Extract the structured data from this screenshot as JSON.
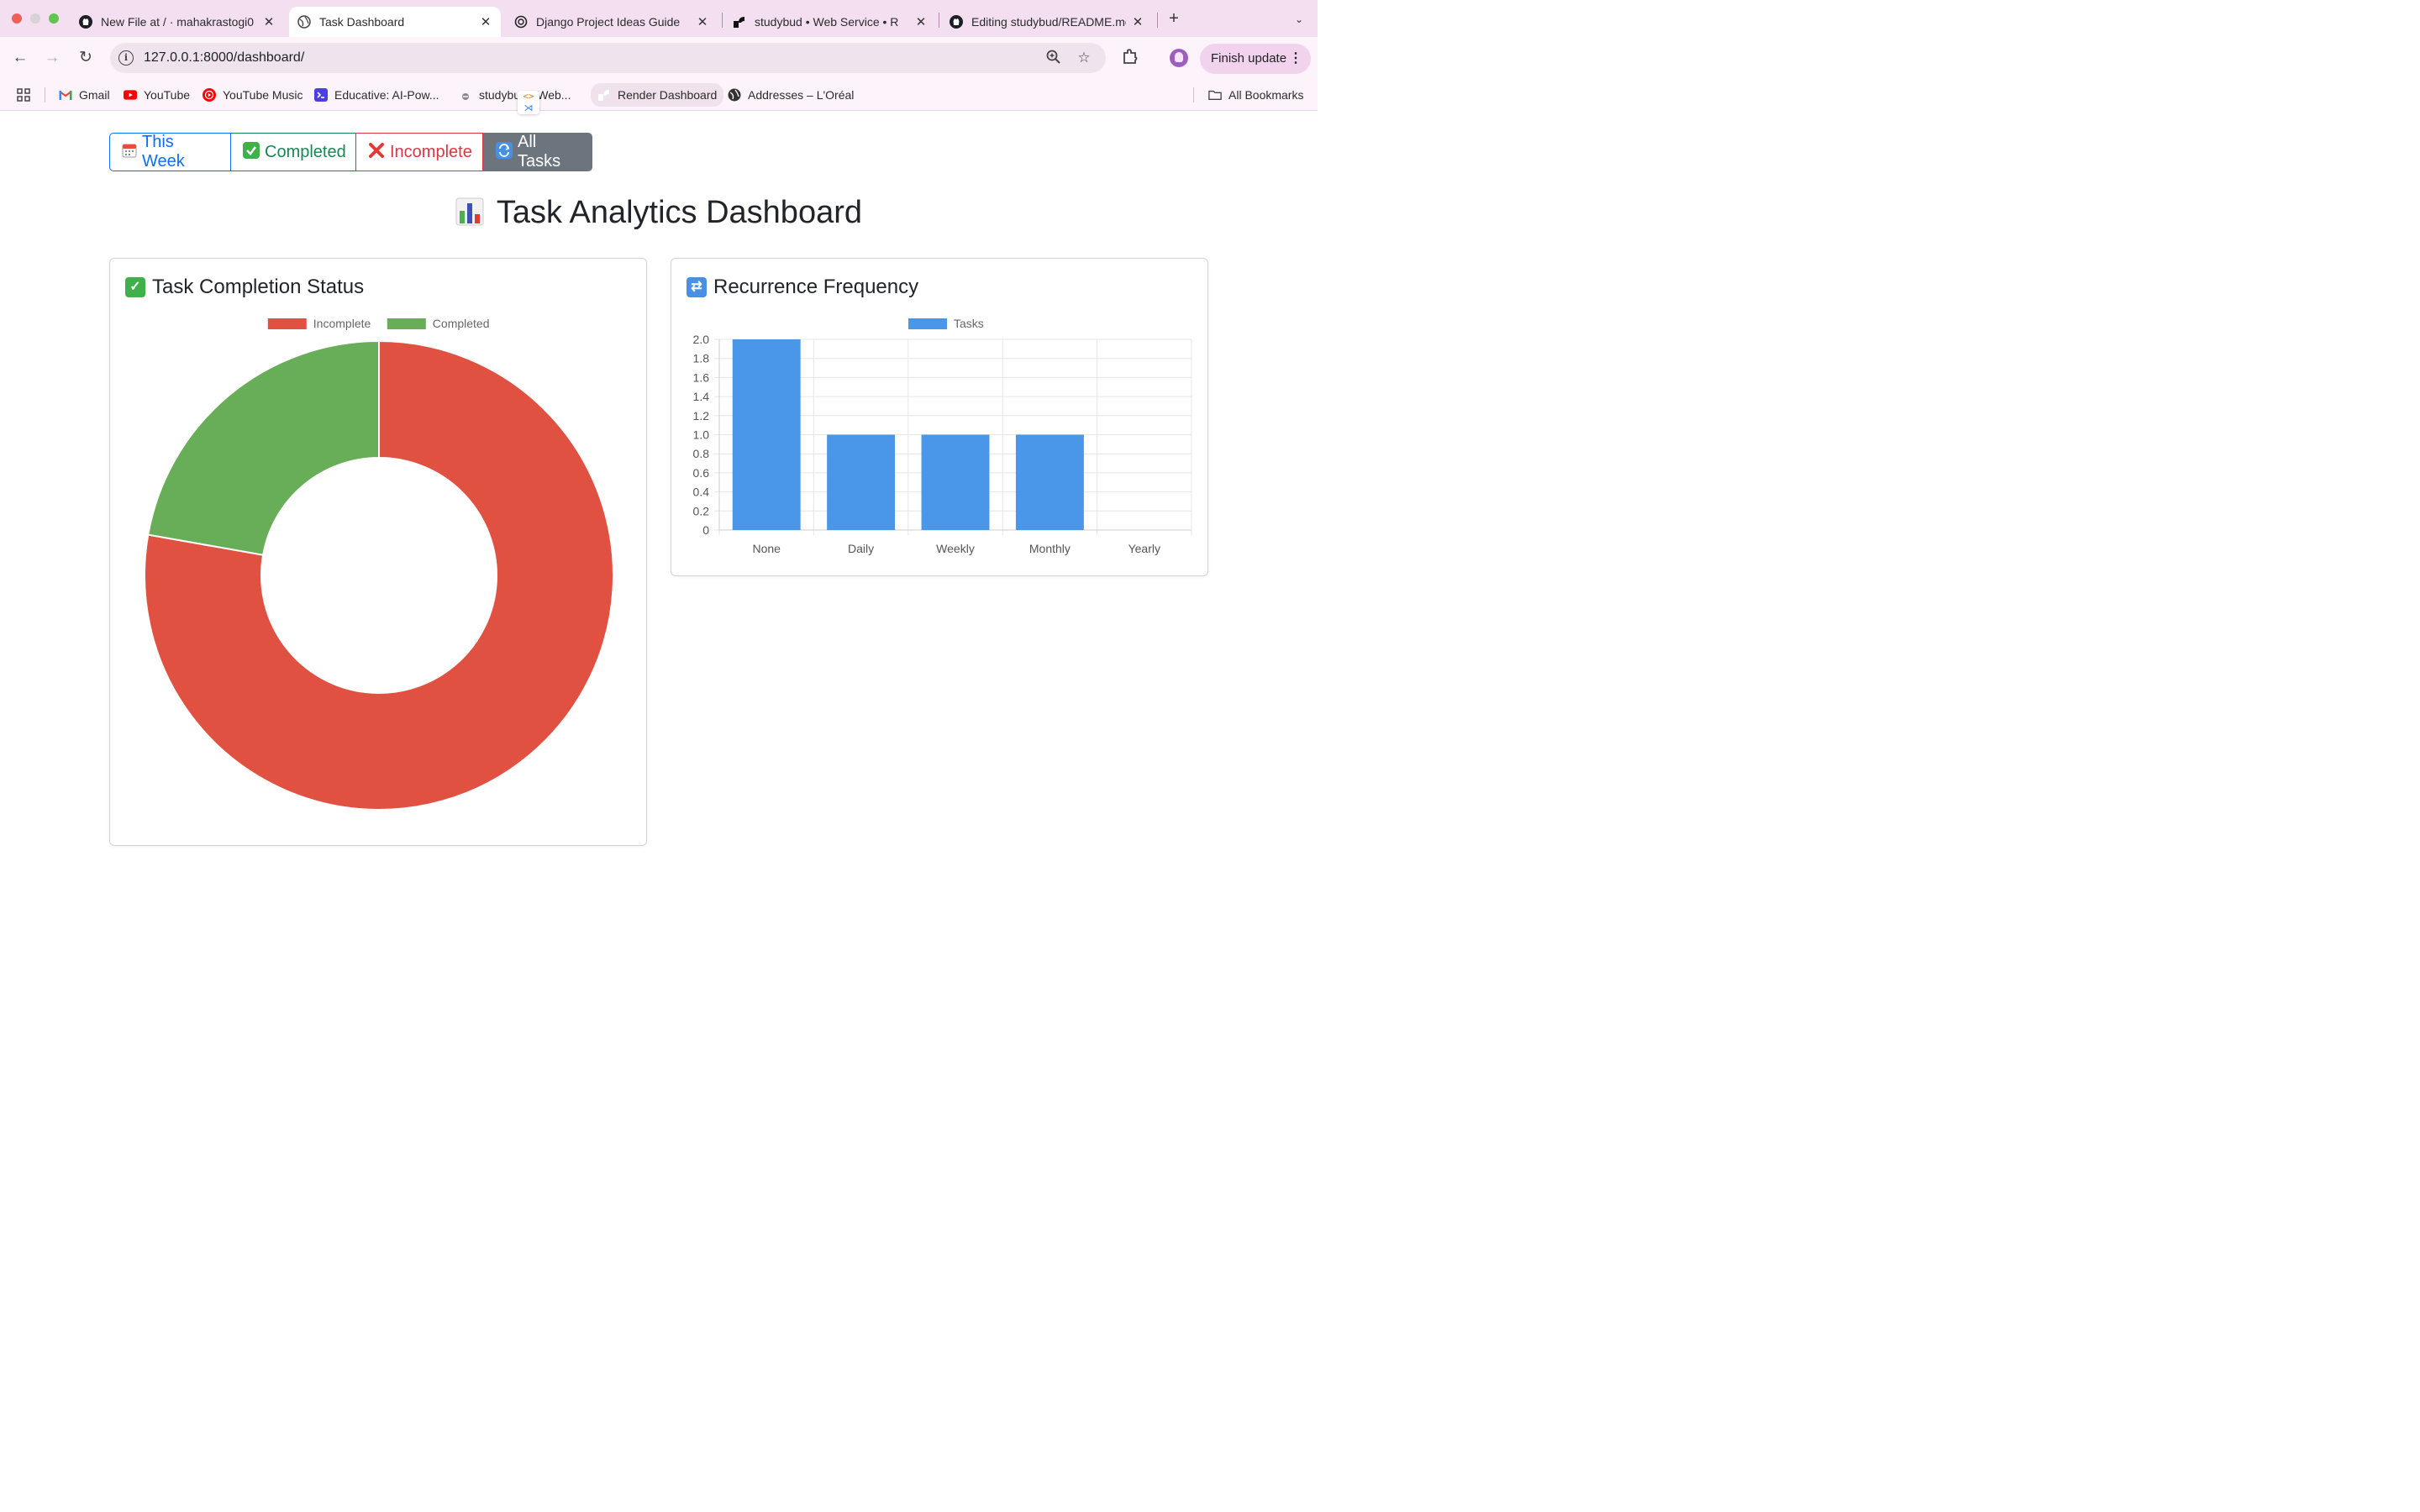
{
  "browser": {
    "tabs": [
      {
        "title": "New File at / · mahakrastogi0",
        "icon": "github-icon",
        "active": false
      },
      {
        "title": "Task Dashboard",
        "icon": "globe-icon",
        "active": true
      },
      {
        "title": "Django Project Ideas Guide",
        "icon": "openai-icon",
        "active": false
      },
      {
        "title": "studybud • Web Service • R",
        "icon": "render-icon",
        "active": false
      },
      {
        "title": "Editing studybud/README.md",
        "icon": "github-icon",
        "active": false
      }
    ],
    "url": "127.0.0.1:8000/dashboard/",
    "finish_update": "Finish update",
    "bookmarks": [
      {
        "label": "Gmail",
        "icon": "gmail-icon"
      },
      {
        "label": "YouTube",
        "icon": "youtube-icon"
      },
      {
        "label": "YouTube Music",
        "icon": "youtube-music-icon"
      },
      {
        "label": "Educative: AI-Pow...",
        "icon": "educative-icon"
      },
      {
        "label": "studybud · Web...",
        "icon": "render-icon"
      },
      {
        "label": "Render Dashboard",
        "icon": "render-icon"
      },
      {
        "label": "Addresses – L'Oréal",
        "icon": "globe-icon"
      }
    ],
    "all_bookmarks": "All Bookmarks"
  },
  "filters": [
    {
      "label": "This Week",
      "icon": "calendar-icon"
    },
    {
      "label": "Completed",
      "icon": "check-icon"
    },
    {
      "label": "Incomplete",
      "icon": "cross-icon"
    },
    {
      "label": "All Tasks",
      "icon": "refresh-icon"
    }
  ],
  "page_title": "Task Analytics Dashboard",
  "colors": {
    "incomplete": "#e15141",
    "completed": "#68ad58",
    "bar": "#4a96e8",
    "primary": "#0d6efd",
    "success": "#198754",
    "danger": "#dc3545",
    "secondary": "#6c757d"
  },
  "chart_data": [
    {
      "type": "doughnut",
      "title": "Task Completion Status",
      "legend_position": "top",
      "categories": [
        "Incomplete",
        "Completed"
      ],
      "values": [
        7,
        2
      ]
    },
    {
      "type": "bar",
      "title": "Recurrence Frequency",
      "legend_position": "top",
      "categories": [
        "None",
        "Daily",
        "Weekly",
        "Monthly",
        "Yearly"
      ],
      "series": [
        {
          "name": "Tasks",
          "values": [
            2,
            1,
            1,
            1,
            0
          ]
        }
      ],
      "ylim": [
        0,
        2
      ],
      "yticks": [
        "0",
        "0.2",
        "0.4",
        "0.6",
        "0.8",
        "1.0",
        "1.2",
        "1.4",
        "1.6",
        "1.8",
        "2.0"
      ],
      "grid": true
    }
  ]
}
